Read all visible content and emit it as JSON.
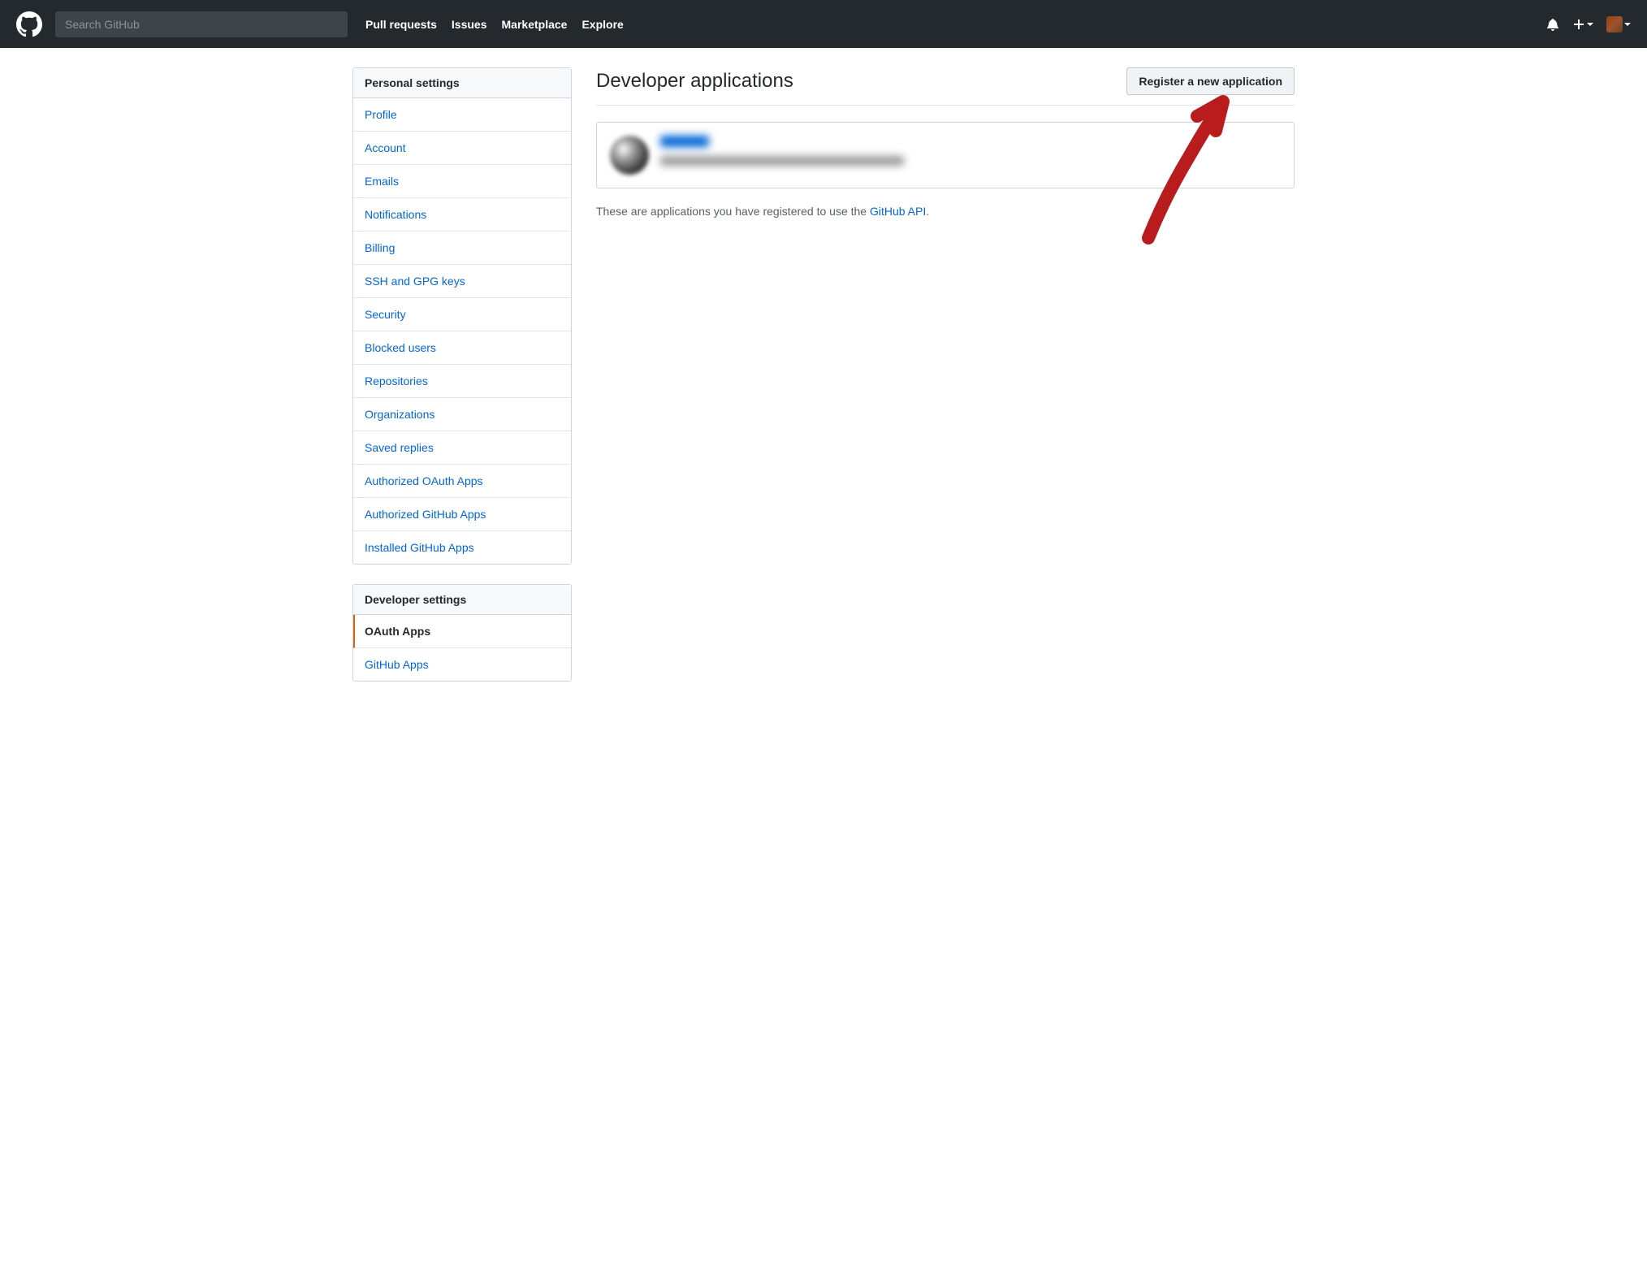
{
  "header": {
    "search_placeholder": "Search GitHub",
    "nav": {
      "pull_requests": "Pull requests",
      "issues": "Issues",
      "marketplace": "Marketplace",
      "explore": "Explore"
    }
  },
  "sidebar": {
    "personal_settings_header": "Personal settings",
    "personal_items": [
      {
        "label": "Profile"
      },
      {
        "label": "Account"
      },
      {
        "label": "Emails"
      },
      {
        "label": "Notifications"
      },
      {
        "label": "Billing"
      },
      {
        "label": "SSH and GPG keys"
      },
      {
        "label": "Security"
      },
      {
        "label": "Blocked users"
      },
      {
        "label": "Repositories"
      },
      {
        "label": "Organizations"
      },
      {
        "label": "Saved replies"
      },
      {
        "label": "Authorized OAuth Apps"
      },
      {
        "label": "Authorized GitHub Apps"
      },
      {
        "label": "Installed GitHub Apps"
      }
    ],
    "developer_settings_header": "Developer settings",
    "developer_items": [
      {
        "label": "OAuth Apps",
        "active": true
      },
      {
        "label": "GitHub Apps"
      }
    ]
  },
  "main": {
    "title": "Developer applications",
    "register_button": "Register a new application",
    "footer_text_prefix": "These are applications you have registered to use the ",
    "footer_link_text": "GitHub API",
    "footer_text_suffix": "."
  }
}
